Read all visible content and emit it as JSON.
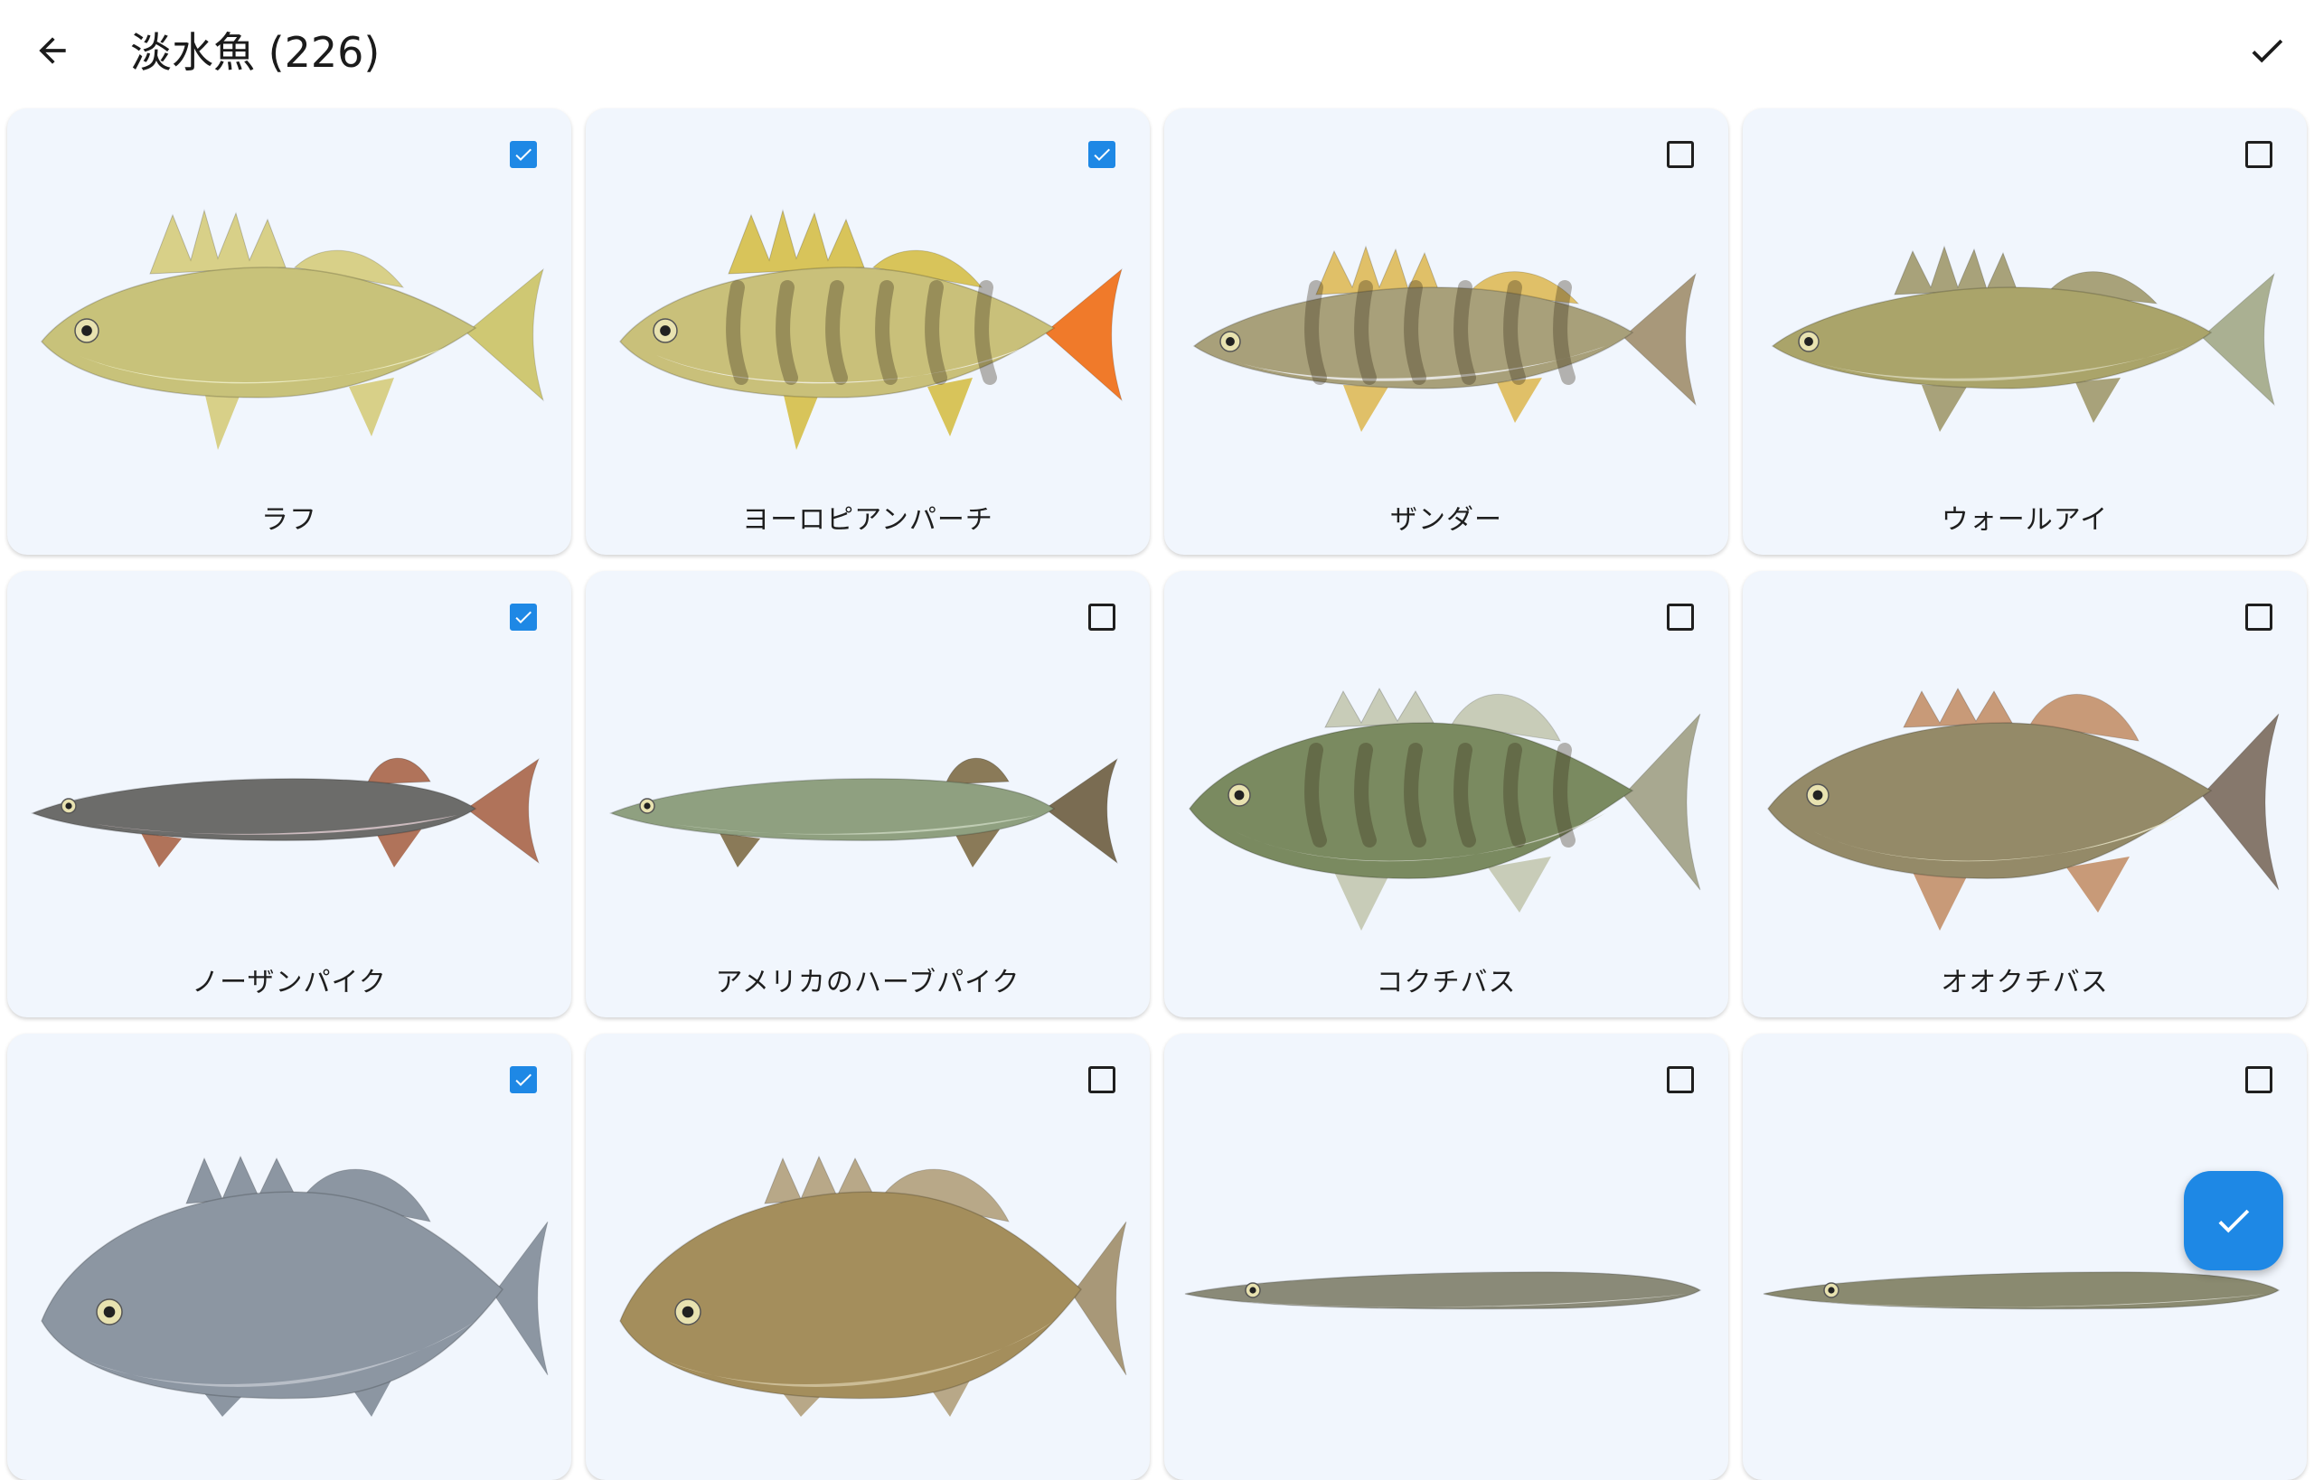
{
  "header": {
    "title": "淡水魚 (226)",
    "back_icon": "arrow-left-icon",
    "done_icon": "check-icon"
  },
  "colors": {
    "accent": "#1e88e5",
    "card_background": "#f1f6fd",
    "text": "#1f1f1f"
  },
  "fish": [
    {
      "name": "ラフ",
      "checked": true,
      "shape": "perch",
      "body": "#c8c27a",
      "belly": "#eeeec8",
      "fins": "#d8d088",
      "tail": "#cfc873",
      "bars": false
    },
    {
      "name": "ヨーロピアンパーチ",
      "checked": true,
      "shape": "perch",
      "body": "#c9c07a",
      "belly": "#f2f0e4",
      "fins": "#d8c45a",
      "tail": "#f07a2a",
      "bars": true
    },
    {
      "name": "ザンダー",
      "checked": false,
      "shape": "zander",
      "body": "#a8a07a",
      "belly": "#efeef0",
      "fins": "#e0c068",
      "tail": "#a8987a",
      "bars": true
    },
    {
      "name": "ウォールアイ",
      "checked": false,
      "shape": "zander",
      "body": "#aaa46a",
      "belly": "#d8d6b6",
      "fins": "#a8a27a",
      "tail": "#aab092",
      "bars": false
    },
    {
      "name": "ノーザンパイク",
      "checked": true,
      "shape": "pike",
      "body": "#6c6c6a",
      "belly": "#dcc8cc",
      "fins": "#b0735a",
      "tail": "#b0735a",
      "bars": false
    },
    {
      "name": "アメリカのハーブパイク",
      "checked": false,
      "shape": "pike",
      "body": "#8fa080",
      "belly": "#c8d4bc",
      "fins": "#8a7a58",
      "tail": "#7a6c52",
      "bars": false
    },
    {
      "name": "コクチバス",
      "checked": false,
      "shape": "bass",
      "body": "#7a8a60",
      "belly": "#cfd2c6",
      "fins": "#c8ccb8",
      "tail": "#a8a890",
      "bars": true
    },
    {
      "name": "オオクチバス",
      "checked": false,
      "shape": "bass",
      "body": "#948a68",
      "belly": "#e8e4c8",
      "fins": "#c89a78",
      "tail": "#86786c",
      "bars": false
    },
    {
      "name": "",
      "checked": true,
      "shape": "crappie",
      "body": "#8c96a2",
      "belly": "#c0c6ce",
      "fins": "#8c96a2",
      "tail": "#8c96a2",
      "bars": false
    },
    {
      "name": "",
      "checked": false,
      "shape": "crappie",
      "body": "#a48e5c",
      "belly": "#d4c6a0",
      "fins": "#b8a888",
      "tail": "#a89878",
      "bars": false
    },
    {
      "name": "",
      "checked": false,
      "shape": "eel",
      "body": "#8a8a78",
      "belly": "#d8d8d0",
      "fins": "#8a8a78",
      "tail": "#8a8a78",
      "bars": false
    },
    {
      "name": "",
      "checked": false,
      "shape": "eel",
      "body": "#8a8a70",
      "belly": "#d8d8cc",
      "fins": "#8a8a70",
      "tail": "#8a8a70",
      "bars": false
    }
  ],
  "fab": {
    "icon": "check-icon"
  }
}
